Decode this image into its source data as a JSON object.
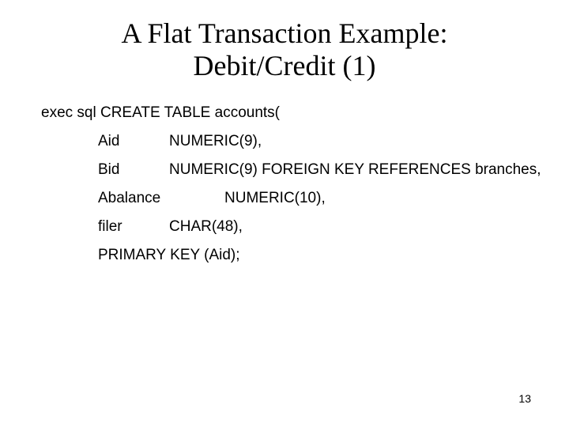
{
  "title": {
    "line1": "A Flat Transaction Example:",
    "line2": "Debit/Credit (1)"
  },
  "sql": {
    "create_line": "exec sql CREATE TABLE accounts(",
    "cols": {
      "aid_name": "Aid",
      "aid_type": "NUMERIC(9),",
      "bid_name": "Bid",
      "bid_type": "NUMERIC(9) FOREIGN KEY REFERENCES branches,",
      "abalance_name": "Abalance",
      "abalance_type": "NUMERIC(10),",
      "filer_name": "filer",
      "filer_type": "CHAR(48),",
      "pk": "PRIMARY KEY (Aid);"
    }
  },
  "page_number": "13"
}
